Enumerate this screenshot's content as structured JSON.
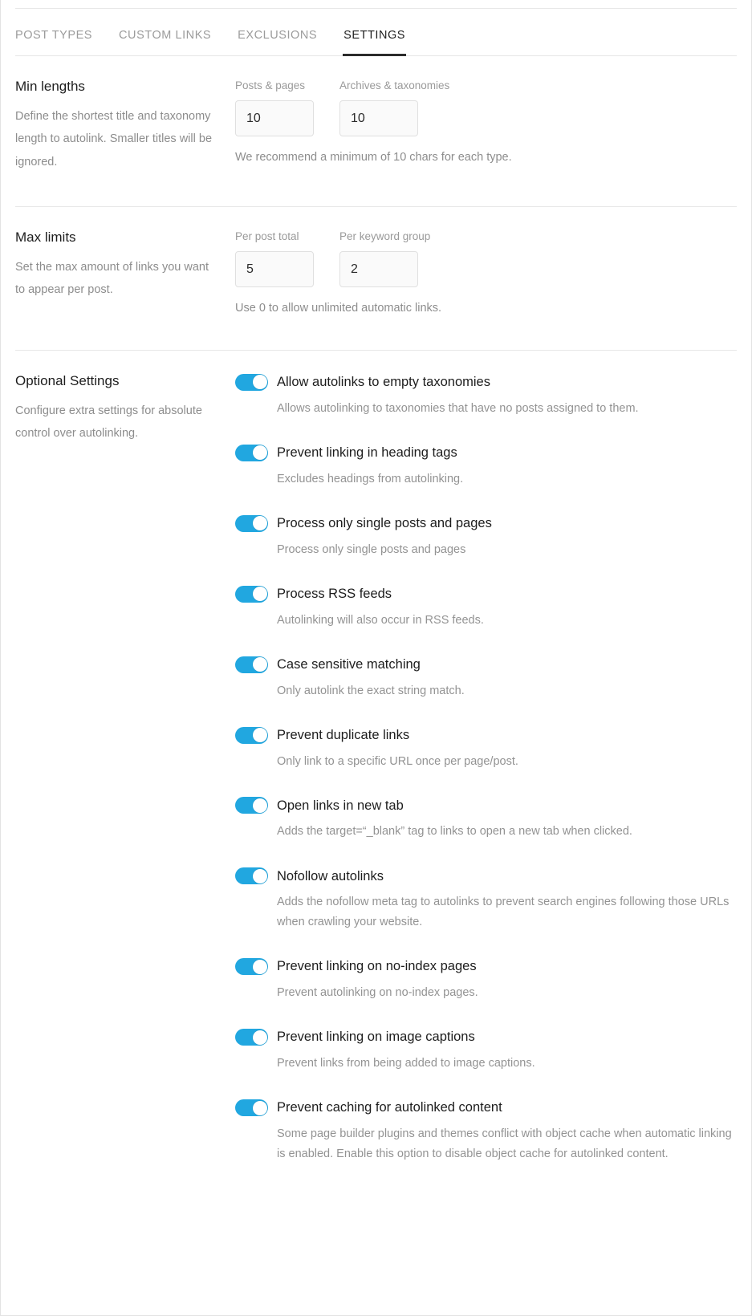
{
  "tabs": [
    {
      "label": "POST TYPES",
      "active": false
    },
    {
      "label": "CUSTOM LINKS",
      "active": false
    },
    {
      "label": "EXCLUSIONS",
      "active": false
    },
    {
      "label": "SETTINGS",
      "active": true
    }
  ],
  "accent_color": "#21a7e0",
  "sections": {
    "min_lengths": {
      "title": "Min lengths",
      "description": "Define the shortest title and taxonomy length to autolink. Smaller titles will be ignored.",
      "fields": [
        {
          "label": "Posts & pages",
          "value": "10"
        },
        {
          "label": "Archives & taxonomies",
          "value": "10"
        }
      ],
      "hint": "We recommend a minimum of 10 chars for each type."
    },
    "max_limits": {
      "title": "Max limits",
      "description": "Set the max amount of links you want to appear per post.",
      "fields": [
        {
          "label": "Per post total",
          "value": "5"
        },
        {
          "label": "Per keyword group",
          "value": "2"
        }
      ],
      "hint": "Use 0 to allow unlimited automatic links."
    },
    "optional_settings": {
      "title": "Optional Settings",
      "description": "Configure extra settings for absolute control over autolinking.",
      "toggles": [
        {
          "name": "allow-autolinks-empty-taxonomies",
          "label": "Allow autolinks to empty taxonomies",
          "description": "Allows autolinking to taxonomies that have no posts assigned to them.",
          "on": true
        },
        {
          "name": "prevent-linking-heading-tags",
          "label": "Prevent linking in heading tags",
          "description": "Excludes headings from autolinking.",
          "on": true
        },
        {
          "name": "process-only-single-posts-pages",
          "label": "Process only single posts and pages",
          "description": "Process only single posts and pages",
          "on": true
        },
        {
          "name": "process-rss-feeds",
          "label": "Process RSS feeds",
          "description": "Autolinking will also occur in RSS feeds.",
          "on": true
        },
        {
          "name": "case-sensitive-matching",
          "label": "Case sensitive matching",
          "description": "Only autolink the exact string match.",
          "on": true
        },
        {
          "name": "prevent-duplicate-links",
          "label": "Prevent duplicate links",
          "description": "Only link to a specific URL once per page/post.",
          "on": true
        },
        {
          "name": "open-links-new-tab",
          "label": "Open links in new tab",
          "description": "Adds the target=“_blank” tag to links to open a new tab when clicked.",
          "on": true
        },
        {
          "name": "nofollow-autolinks",
          "label": "Nofollow autolinks",
          "description": "Adds the nofollow meta tag to autolinks to prevent search engines following those URLs when crawling your website.",
          "on": true
        },
        {
          "name": "prevent-linking-no-index-pages",
          "label": "Prevent linking on no-index pages",
          "description": "Prevent autolinking on no-index pages.",
          "on": true
        },
        {
          "name": "prevent-linking-image-captions",
          "label": "Prevent linking on image captions",
          "description": "Prevent links from being added to image captions.",
          "on": true
        },
        {
          "name": "prevent-caching-autolinked-content",
          "label": "Prevent caching for autolinked content",
          "description": "Some page builder plugins and themes conflict with object cache when automatic linking is enabled. Enable this option to disable object cache for autolinked content.",
          "on": true
        }
      ]
    }
  }
}
